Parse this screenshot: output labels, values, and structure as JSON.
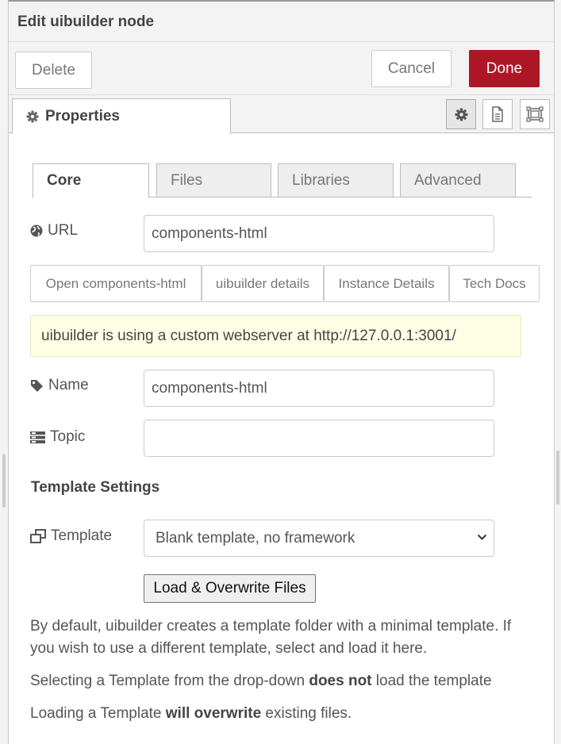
{
  "header": {
    "title": "Edit uibuilder node"
  },
  "toolbar": {
    "delete_label": "Delete",
    "cancel_label": "Cancel",
    "done_label": "Done"
  },
  "properties_tab": {
    "label": "Properties",
    "icons": [
      "gear-icon",
      "document-icon",
      "frame-icon"
    ]
  },
  "tabs": [
    {
      "label": "Core",
      "active": true
    },
    {
      "label": "Files",
      "active": false
    },
    {
      "label": "Libraries",
      "active": false
    },
    {
      "label": "Advanced",
      "active": false
    }
  ],
  "url": {
    "label": "URL",
    "value": "components-html",
    "icon": "globe-icon"
  },
  "link_buttons": [
    "Open components-html",
    "uibuilder details",
    "Instance Details",
    "Tech Docs"
  ],
  "notice": "uibuilder is using a custom webserver at http://127.0.0.1:3001/",
  "name": {
    "label": "Name",
    "value": "components-html",
    "icon": "tag-icon"
  },
  "topic": {
    "label": "Topic",
    "value": "",
    "icon": "tasks-icon"
  },
  "template_settings": {
    "title": "Template Settings",
    "label": "Template",
    "icon": "clone-icon",
    "selected": "Blank template, no framework",
    "load_label": "Load & Overwrite Files"
  },
  "help": {
    "p1": "By default, uibuilder creates a template folder with a minimal template. If you wish to use a different template, select and load it here.",
    "p2_pre": "Selecting a Template from the drop-down ",
    "p2_bold": "does not",
    "p2_post": " load the template",
    "p3_pre": "Loading a Template ",
    "p3_bold": "will overwrite",
    "p3_post": " existing files."
  },
  "colors": {
    "done": "#ad1625",
    "notice_bg": "#ffffe6"
  }
}
